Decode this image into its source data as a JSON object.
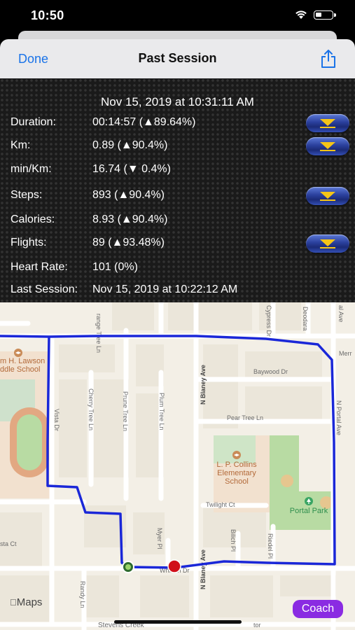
{
  "status": {
    "time": "10:50"
  },
  "nav": {
    "done_label": "Done",
    "title": "Past Session"
  },
  "session": {
    "date": "Nov 15, 2019 at 10:31:11 AM",
    "rows": [
      {
        "label": "Duration:",
        "value": "00:14:57 (▲89.64%)"
      },
      {
        "label": "Km:",
        "value": "0.89 (▲90.4%)"
      },
      {
        "label": "min/Km:",
        "value": "16.74 (▼ 0.4%)"
      },
      {
        "label": "Steps:",
        "value": "893 (▲90.4%)"
      },
      {
        "label": "Calories:",
        "value": "8.93 (▲90.4%)"
      },
      {
        "label": "Flights:",
        "value": "89 (▲93.48%)"
      },
      {
        "label": "Heart Rate:",
        "value": "101 (0%)"
      },
      {
        "label": "Last Session:",
        "value": "Nov 15, 2019 at 10:22:12 AM"
      }
    ]
  },
  "map": {
    "streets": {
      "orange_tree": "range Tree Ln",
      "cypress": "Cypress Dr",
      "deodara": "Deodara",
      "portal_ave_top": "al Ave",
      "merr": "Merr",
      "baywood": "Baywood Dr",
      "cherry": "Cherry Tree Ln",
      "prune": "Prune Tree Ln",
      "plum": "Plum Tree Ln",
      "blaney_top": "N Blaney Ave",
      "n_portal": "N Portal Ave",
      "vista": "Vista Dr",
      "pear": "Pear Tree Ln",
      "twilight": "Twilight Ct",
      "sta": "sta Ct",
      "myer": "Myer Pl",
      "blaney_bottom": "N Blaney Ave",
      "bilich": "Bilich Pl",
      "riedel": "Riedel Pl",
      "whitton": "Whitton Dr",
      "randy": "Randy Ln",
      "stevens": "Stevens Creek",
      "tor": "tor"
    },
    "places": {
      "lawson": "m H. Lawson\nddle School",
      "collins": "L. P. Collins\nElementary\nSchool",
      "portal_park": "Portal Park"
    },
    "maps_label": "Maps",
    "coach_label": "Coach",
    "route_color": "#1a27d8",
    "start_color": "#2e6b2e",
    "end_color": "#d0101a"
  }
}
